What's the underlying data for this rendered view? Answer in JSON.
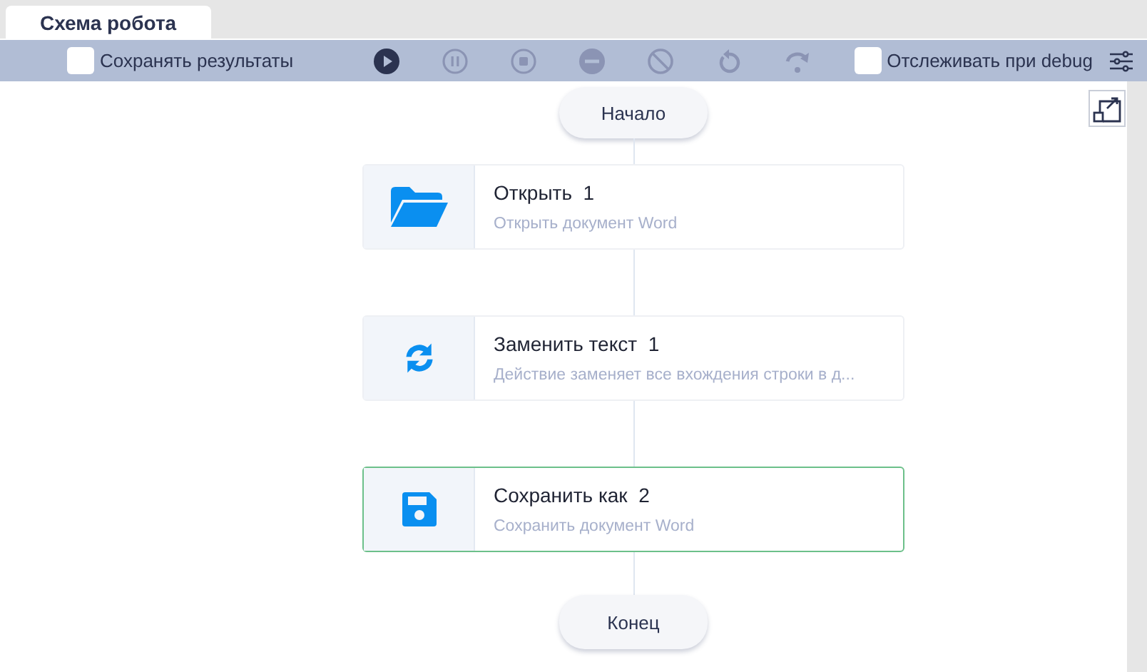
{
  "tabs": [
    {
      "label": "Схема робота",
      "selected": true
    }
  ],
  "toolbar": {
    "save_results": {
      "label": "Сохранять результаты",
      "checked": false
    },
    "controls": [
      {
        "kind": "play",
        "disabled": false
      },
      {
        "kind": "pause",
        "disabled": true
      },
      {
        "kind": "stop",
        "disabled": true
      },
      {
        "kind": "minus",
        "disabled": true
      },
      {
        "kind": "ban",
        "disabled": true
      },
      {
        "kind": "undo",
        "disabled": true
      },
      {
        "kind": "redo",
        "disabled": true
      }
    ],
    "debug_trace": {
      "label": "Отслеживать при debug",
      "checked": false
    }
  },
  "flow": {
    "start": "Начало",
    "end": "Конец",
    "steps": [
      {
        "kind": "folder",
        "title": "Открыть  1",
        "description": "Открыть документ Word",
        "selected": false
      },
      {
        "kind": "refresh",
        "title": "Заменить текст  1",
        "description": "Действие заменяет все вхождения строки в д...",
        "selected": false
      },
      {
        "kind": "save",
        "title": "Сохранить как  2",
        "description": "Сохранить документ Word",
        "selected": true
      }
    ]
  }
}
